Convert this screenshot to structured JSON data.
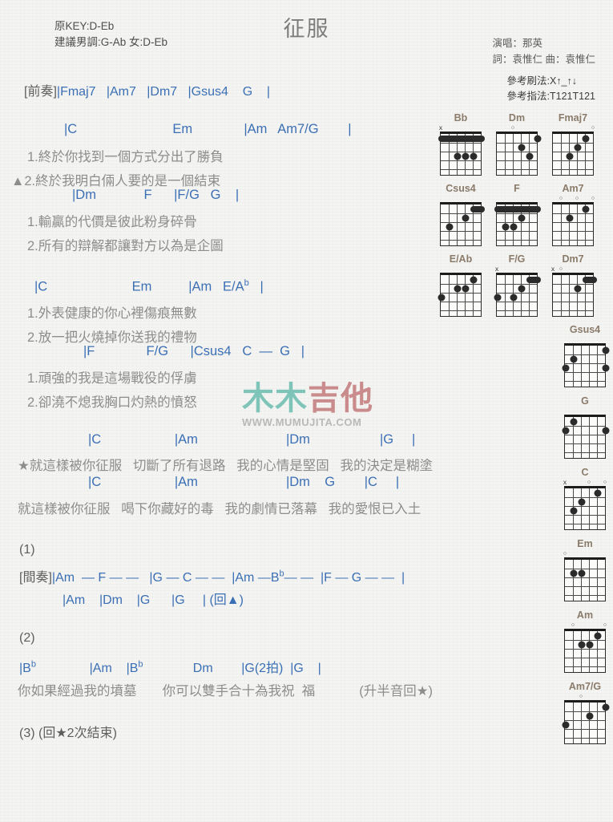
{
  "song": {
    "title": "征服",
    "key_info_line1": "原KEY:D-Eb",
    "key_info_line2": "建議男調:G-Ab 女:D-Eb",
    "singer": "演唱：那英",
    "writers": "詞：袁惟仁  曲：袁惟仁",
    "strum_ref": "參考刷法:X↑_↑↓",
    "finger_ref": "參考指法:T121T121"
  },
  "watermark": {
    "char1": "木",
    "char2": "木",
    "char3": "吉",
    "char4": "他",
    "url": "WWW.MUMUJITA.COM"
  },
  "sections": {
    "intro_label": "[前奏]",
    "intro_chords": "|Fmaj7   |Am7   |Dm7   |Gsus4    G    |",
    "v1_chords_a": "|C                          Em              |Am   Am7/G        |",
    "v1_lyric_1": "1.終於你找到一個方式分出了勝負",
    "v1_lyric_2": "▲2.終於我明白倆人要的是一個結束",
    "v1_chords_b": "|Dm             F      |F/G   G    |",
    "v1_lyric_3": "1.輸贏的代價是彼此粉身碎骨",
    "v1_lyric_4": "2.所有的辯解都讓對方以為是企圖",
    "v2_chords_a": "|C                       Em          |Am   E/A",
    "v2_chords_a_sup": "b",
    "v2_chords_a_end": "   |",
    "v2_lyric_1": "1.外表健康的你心裡傷痕無數",
    "v2_lyric_2": "2.放一把火燒掉你送我的禮物",
    "v2_chords_b": "|F              F/G      |Csus4   C  —  G   |",
    "v2_lyric_3": "1.頑強的我是這場戰役的俘虜",
    "v2_lyric_4": "2.卻澆不熄我胸口灼熱的憤怒",
    "ch1_chords": "|C                    |Am                        |Dm                   |G     |",
    "ch1_lyric": "★就這樣被你征服   切斷了所有退路   我的心情是堅固   我的決定是糊塗",
    "ch2_chords": "|C                    |Am                        |Dm    G        |C     |",
    "ch2_lyric": "就這樣被你征服   喝下你藏好的毒   我的劇情已落幕   我的愛恨已入土",
    "num1": "(1)",
    "interlude_label": "[間奏]",
    "interlude_line1_a": "|Am  — F — —   |G — C — —  |Am —B",
    "interlude_line1_sup": "b",
    "interlude_line1_b": "— —  |F — G — —  |",
    "interlude_line2": "|Am    |Dm    |G      |G     | (回▲)",
    "num2": "(2)",
    "outro_chords_a": "|B",
    "outro_chords_a_sup": "b",
    "outro_chords_b": "               |Am    |B",
    "outro_chords_b_sup": "b",
    "outro_chords_c": "              Dm        |G(2拍)  |G    |",
    "outro_lyric": "你如果經過我的墳墓       你可以雙手合十為我祝  福            (升半音回★)",
    "num3": "(3) (回★2次結束)"
  },
  "diagrams": [
    {
      "name": "Bb",
      "marks": [
        {
          "t": "x",
          "s": 6
        }
      ],
      "barres": [
        {
          "fret": 1,
          "from": 6,
          "to": 1
        }
      ],
      "dots": [
        {
          "fret": 3,
          "string": 4
        },
        {
          "fret": 3,
          "string": 3
        },
        {
          "fret": 3,
          "string": 2
        }
      ]
    },
    {
      "name": "Dm",
      "marks": [
        {
          "t": "o",
          "s": 4
        }
      ],
      "barres": [],
      "dots": [
        {
          "fret": 1,
          "string": 1
        },
        {
          "fret": 2,
          "string": 3
        },
        {
          "fret": 3,
          "string": 2
        }
      ]
    },
    {
      "name": "Fmaj7",
      "marks": [
        {
          "t": "o",
          "s": 1
        }
      ],
      "barres": [],
      "dots": [
        {
          "fret": 1,
          "string": 2
        },
        {
          "fret": 2,
          "string": 3
        },
        {
          "fret": 3,
          "string": 4
        }
      ]
    },
    {
      "name": "Csus4",
      "marks": [],
      "barres": [
        {
          "fret": 1,
          "from": 2,
          "to": 1
        }
      ],
      "dots": [
        {
          "fret": 2,
          "string": 3
        },
        {
          "fret": 3,
          "string": 5
        }
      ]
    },
    {
      "name": "F",
      "marks": [],
      "barres": [
        {
          "fret": 1,
          "from": 6,
          "to": 1
        }
      ],
      "dots": [
        {
          "fret": 2,
          "string": 3
        },
        {
          "fret": 3,
          "string": 5
        },
        {
          "fret": 3,
          "string": 4
        }
      ]
    },
    {
      "name": "Am7",
      "marks": [
        {
          "t": "o",
          "s": 5
        },
        {
          "t": "o",
          "s": 3
        },
        {
          "t": "o",
          "s": 1
        }
      ],
      "barres": [],
      "dots": [
        {
          "fret": 1,
          "string": 2
        },
        {
          "fret": 2,
          "string": 4
        }
      ]
    },
    {
      "name": "E/Ab",
      "marks": [],
      "barres": [],
      "dots": [
        {
          "fret": 1,
          "string": 2
        },
        {
          "fret": 2,
          "string": 4
        },
        {
          "fret": 2,
          "string": 3
        },
        {
          "fret": 3,
          "string": 6
        }
      ]
    },
    {
      "name": "F/G",
      "marks": [
        {
          "t": "x",
          "s": 6
        }
      ],
      "barres": [
        {
          "fret": 1,
          "from": 2,
          "to": 1
        }
      ],
      "dots": [
        {
          "fret": 2,
          "string": 3
        },
        {
          "fret": 3,
          "string": 6
        },
        {
          "fret": 3,
          "string": 4
        }
      ]
    },
    {
      "name": "Dm7",
      "marks": [
        {
          "t": "x",
          "s": 6
        },
        {
          "t": "o",
          "s": 5
        }
      ],
      "barres": [
        {
          "fret": 1,
          "from": 2,
          "to": 1
        }
      ],
      "dots": [
        {
          "fret": 2,
          "string": 3
        }
      ]
    },
    {
      "name": "Gsus4",
      "marks": [],
      "barres": [],
      "dots": [
        {
          "fret": 1,
          "string": 1
        },
        {
          "fret": 2,
          "string": 5
        },
        {
          "fret": 3,
          "string": 6
        },
        {
          "fret": 3,
          "string": 1
        }
      ]
    },
    {
      "name": "G",
      "marks": [],
      "barres": [],
      "dots": [
        {
          "fret": 1,
          "string": 5
        },
        {
          "fret": 2,
          "string": 6
        },
        {
          "fret": 2,
          "string": 1
        }
      ]
    },
    {
      "name": "C",
      "marks": [
        {
          "t": "x",
          "s": 6
        },
        {
          "t": "o",
          "s": 3
        },
        {
          "t": "o",
          "s": 1
        }
      ],
      "barres": [],
      "dots": [
        {
          "fret": 1,
          "string": 2
        },
        {
          "fret": 2,
          "string": 4
        },
        {
          "fret": 3,
          "string": 5
        }
      ]
    },
    {
      "name": "Em",
      "marks": [
        {
          "t": "o",
          "s": 6
        }
      ],
      "barres": [],
      "dots": [
        {
          "fret": 2,
          "string": 5
        },
        {
          "fret": 2,
          "string": 4
        }
      ]
    },
    {
      "name": "Am",
      "marks": [
        {
          "t": "o",
          "s": 5
        },
        {
          "t": "o",
          "s": 1
        }
      ],
      "barres": [],
      "dots": [
        {
          "fret": 1,
          "string": 2
        },
        {
          "fret": 2,
          "string": 4
        },
        {
          "fret": 2,
          "string": 3
        }
      ]
    },
    {
      "name": "Am7/G",
      "marks": [
        {
          "t": "o",
          "s": 4
        }
      ],
      "barres": [],
      "dots": [
        {
          "fret": 1,
          "string": 1
        },
        {
          "fret": 2,
          "string": 3
        },
        {
          "fret": 3,
          "string": 6
        }
      ]
    }
  ],
  "layout": {
    "rows": [
      3,
      3,
      3,
      1,
      1,
      1,
      1,
      1,
      1
    ]
  }
}
